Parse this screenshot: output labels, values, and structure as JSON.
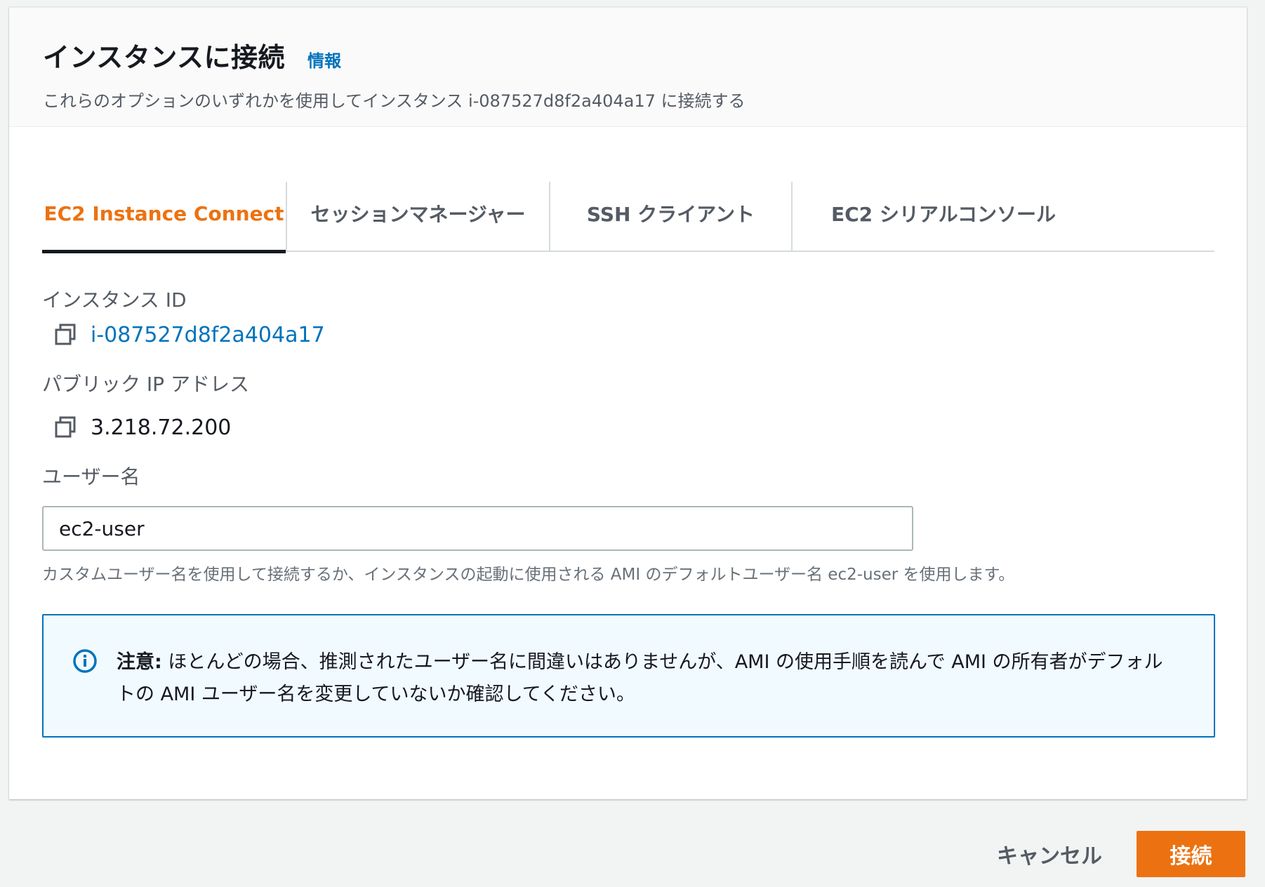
{
  "header": {
    "title": "インスタンスに接続",
    "info_link": "情報",
    "subtitle": "これらのオプションのいずれかを使用してインスタンス i-087527d8f2a404a17 に接続する"
  },
  "tabs": [
    {
      "label": "EC2 Instance Connect",
      "active": true
    },
    {
      "label": "セッションマネージャー",
      "active": false
    },
    {
      "label": "SSH クライアント",
      "active": false
    },
    {
      "label": "EC2 シリアルコンソール",
      "active": false
    }
  ],
  "instance_id": {
    "label": "インスタンス ID",
    "value": "i-087527d8f2a404a17",
    "icon": "copy-icon"
  },
  "public_ip": {
    "label": "パブリック IP アドレス",
    "value": "3.218.72.200",
    "icon": "copy-icon"
  },
  "username": {
    "label": "ユーザー名",
    "value": "ec2-user",
    "hint": "カスタムユーザー名を使用して接続するか、インスタンスの起動に使用される AMI のデフォルトユーザー名 ec2-user を使用します。"
  },
  "alert": {
    "icon": "info-icon",
    "bold": "注意:",
    "text": "ほとんどの場合、推測されたユーザー名に間違いはありませんが、AMI の使用手順を読んで AMI の所有者がデフォルトの AMI ユーザー名を変更していないか確認してください。"
  },
  "footer": {
    "cancel_label": "キャンセル",
    "connect_label": "接続"
  },
  "colors": {
    "accent": "#ec7211",
    "link": "#0073bb",
    "alert_bg": "#f1faff"
  }
}
